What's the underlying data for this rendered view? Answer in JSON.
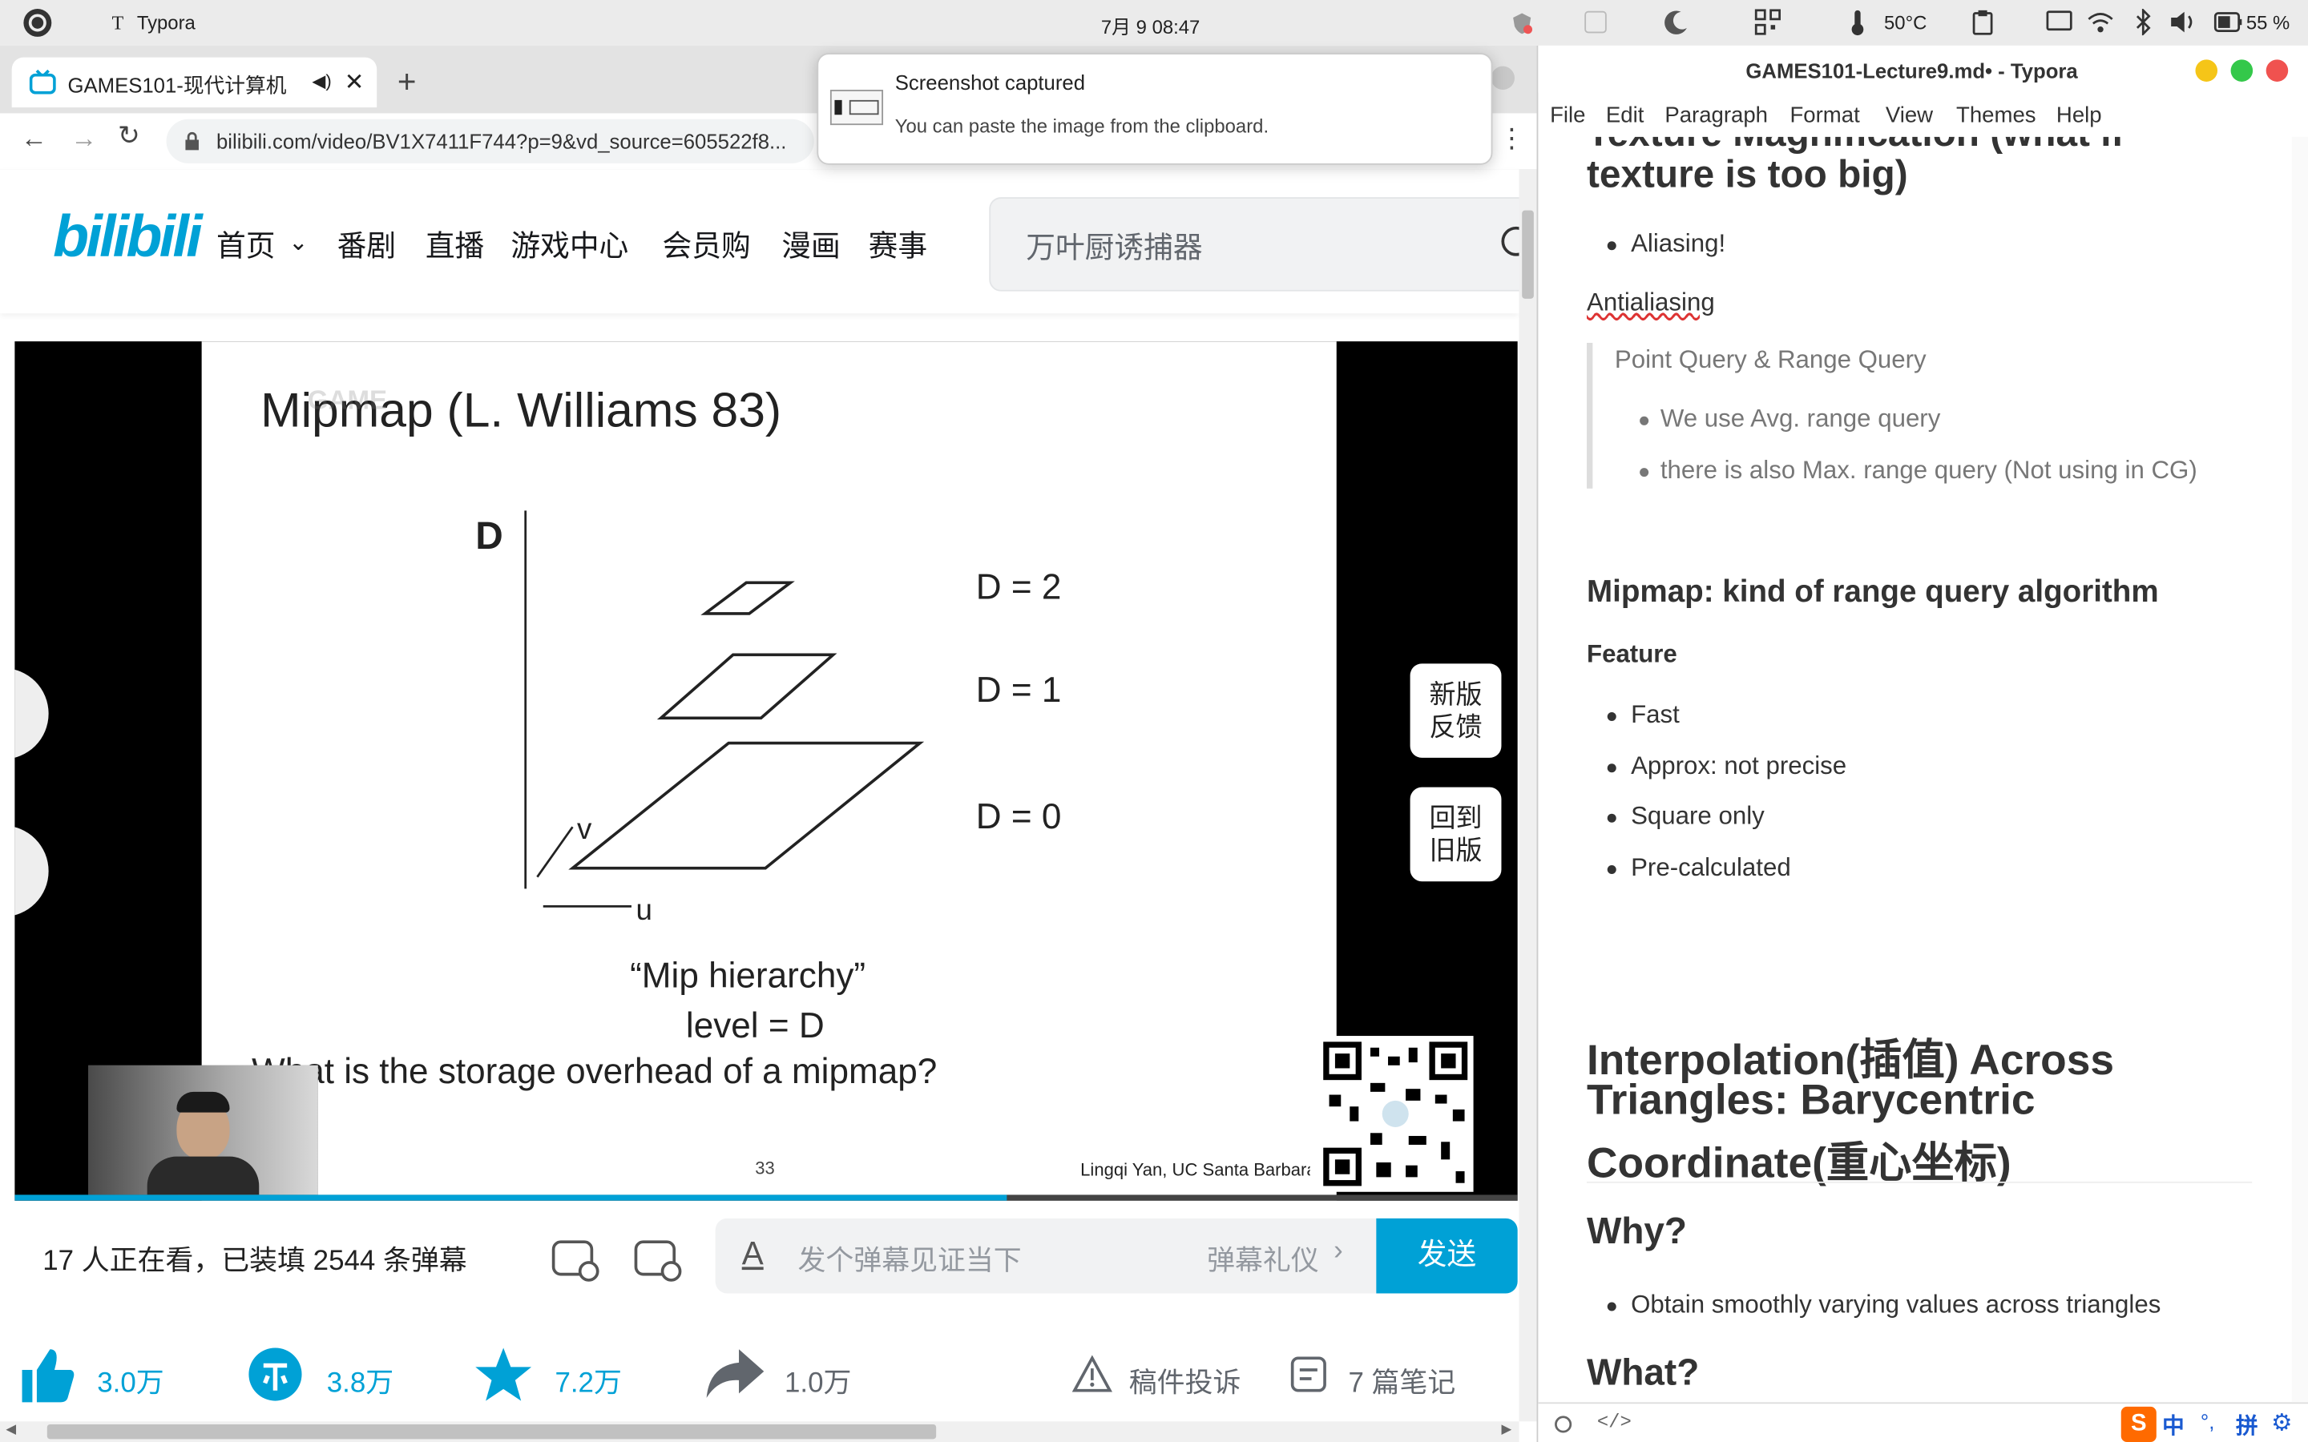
{
  "topbar": {
    "app_name": "Typora",
    "datetime": "7月 9  08:47",
    "temperature": "50°C",
    "battery": "55 %"
  },
  "browser": {
    "tab_title": "GAMES101-现代计算机",
    "url": "bilibili.com/video/BV1X7411F744?p=9&vd_source=605522f8...",
    "nav": {
      "logo": "bilibili",
      "home": "首页",
      "bangumi": "番剧",
      "live": "直播",
      "game": "游戏中心",
      "vip": "会员购",
      "manga": "漫画",
      "match": "赛事",
      "search_placeholder": "万叶厨诱捕器"
    },
    "slide": {
      "watermark": "GAME",
      "title": "Mipmap (L. Williams 83)",
      "axis_d": "D",
      "axis_u": "u",
      "axis_v": "v",
      "d2": "D = 2",
      "d1": "D = 1",
      "d0": "D = 0",
      "caption1": "“Mip hierarchy”",
      "caption2": "level = D",
      "question": "What is the storage overhead of a mipmap?",
      "page": "33",
      "credit": "Lingqi Yan, UC Santa Barbara"
    },
    "side_buttons": {
      "feedback": "新版\n反馈",
      "old": "回到\n旧版"
    },
    "progress": 0.66,
    "danmu": {
      "viewers": "17 人正在看，已装填 2544 条弹幕",
      "input_placeholder": "发个弹幕见证当下",
      "etiquette": "弹幕礼仪",
      "send": "发送"
    },
    "actions": {
      "like": "3.0万",
      "coin": "3.8万",
      "fav": "7.2万",
      "share": "1.0万",
      "report": "稿件投诉",
      "notes": "7 篇笔记"
    }
  },
  "notification": {
    "title": "Screenshot captured",
    "body": "You can paste the image from the clipboard."
  },
  "typora": {
    "title": "GAMES101-Lecture9.md• - Typora",
    "menu": [
      "File",
      "Edit",
      "Paragraph",
      "Format",
      "View",
      "Themes",
      "Help"
    ],
    "content": {
      "h_partial_1": "Texture Magnification (what if",
      "h_partial_2": "texture is too big)",
      "b_aliasing": "Aliasing!",
      "antialiasing": "Antialiasing",
      "quote_title": "Point Query & Range Query",
      "quote_b1": "We use Avg. range query",
      "quote_b2": "there is also Max. range query (Not using in CG)",
      "h_mipmap": "Mipmap: kind of range query algorithm",
      "feature": "Feature",
      "f1": "Fast",
      "f2": "Approx: not precise",
      "f3": "Square only",
      "f4": "Pre-calculated",
      "h_interp_1": "Interpolation(插值) Across",
      "h_interp_2": "Triangles: Barycentric",
      "h_interp_3": "Coordinate(重心坐标)",
      "h_why": "Why?",
      "why_b1": "Obtain smoothly varying values across triangles",
      "h_what": "What?"
    }
  },
  "ime": {
    "lang": "中",
    "punct": "°,",
    "pinyin": "拼"
  }
}
